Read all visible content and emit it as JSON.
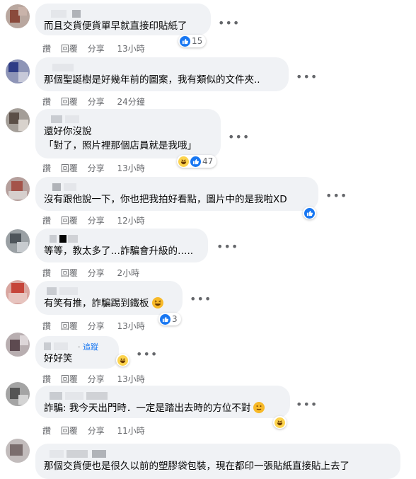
{
  "comments": [
    {
      "text": "而且交貨便貨單早就直接印貼紙了",
      "actions": [
        "讚",
        "回覆",
        "分享"
      ],
      "time": "13小時",
      "reactions": "15"
    },
    {
      "text": "那個聖誕樹是好幾年前的圖案，我有類似的文件夾..",
      "actions": [
        "讚",
        "回覆",
        "分享"
      ],
      "time": "24分鐘"
    },
    {
      "lines": [
        "還好你沒說",
        "「對了，照片裡那個店員就是我哦」"
      ],
      "actions": [
        "讚",
        "回覆",
        "分享"
      ],
      "time": "13小時",
      "reactions": "47"
    },
    {
      "text": "沒有跟他說一下，你也把我拍好看點，圖片中的是我啦XD",
      "actions": [
        "讚",
        "回覆",
        "分享"
      ],
      "time": "12小時"
    },
    {
      "text": "等等，教太多了…詐騙會升級的…..",
      "actions": [
        "讚",
        "回覆",
        "分享"
      ],
      "time": "2小時"
    },
    {
      "text": "有笑有推，詐騙踢到鐵板",
      "actions": [
        "讚",
        "回覆",
        "分享"
      ],
      "time": "13小時",
      "reactions": "3"
    },
    {
      "follow": "追蹤",
      "text": "好好笑",
      "actions": [
        "讚",
        "回覆",
        "分享"
      ],
      "time": "13小時"
    },
    {
      "text": "詐騙: 我今天出門時．一定是踏出去時的方位不對",
      "actions": [
        "讚",
        "回覆",
        "分享"
      ],
      "time": "11小時"
    },
    {
      "text": "那個交貨便也是很久以前的塑膠袋包裝，現在都印一張貼紙直接貼上去了"
    }
  ],
  "more_icon": "•••",
  "colors": {
    "bubble": "#f0f2f5",
    "meta": "#65676b",
    "like": "#1877f2",
    "follow": "#1877f2"
  }
}
